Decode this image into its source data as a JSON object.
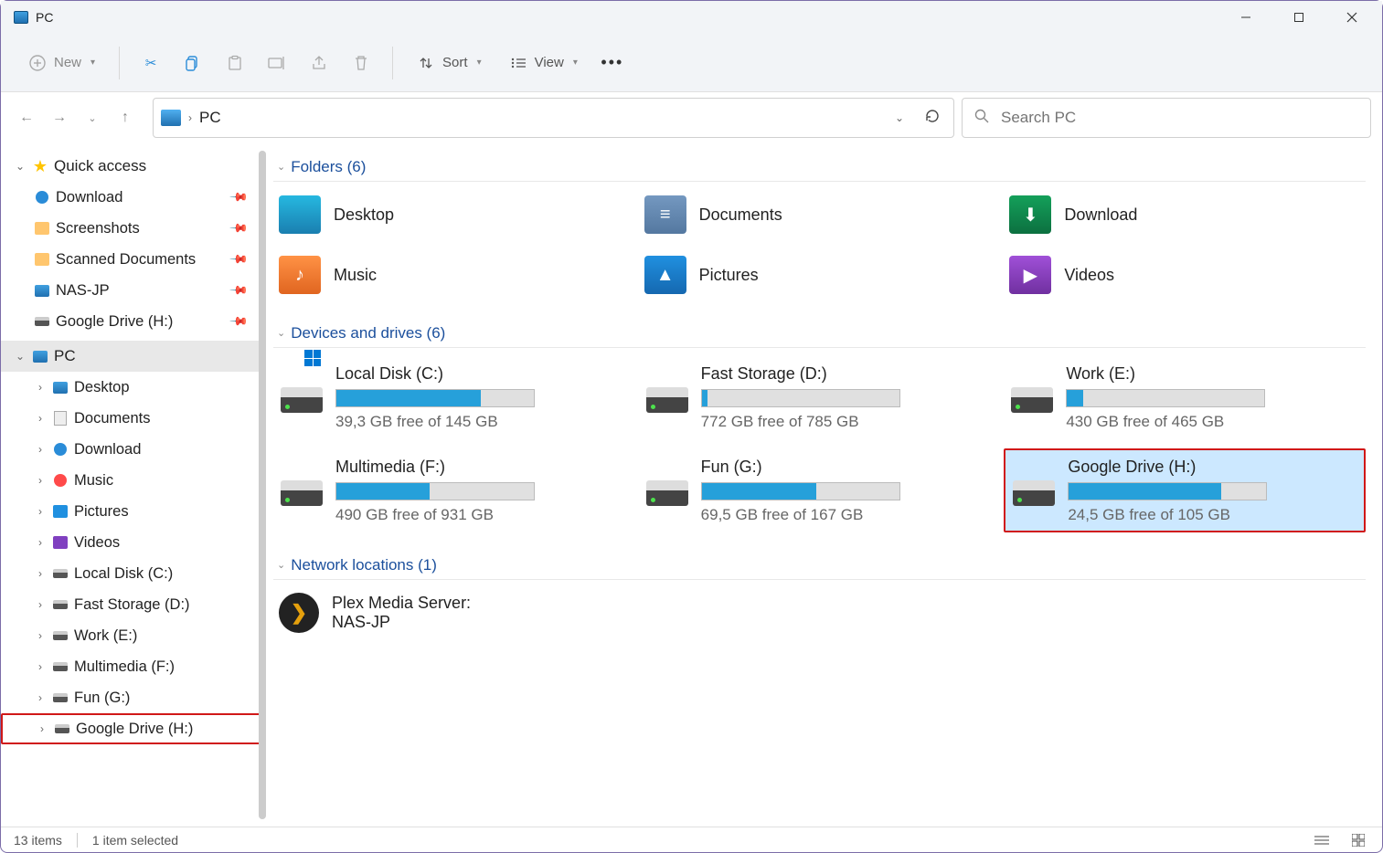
{
  "title": "PC",
  "toolbar": {
    "new_label": "New",
    "sort_label": "Sort",
    "view_label": "View"
  },
  "addressbar": {
    "crumb": "PC"
  },
  "search": {
    "placeholder": "Search PC"
  },
  "nav": {
    "quick_access": "Quick access",
    "qa_items": [
      {
        "label": "Download"
      },
      {
        "label": "Screenshots"
      },
      {
        "label": "Scanned Documents"
      },
      {
        "label": "NAS-JP"
      },
      {
        "label": "Google Drive (H:)"
      }
    ],
    "pc": "PC",
    "pc_items": [
      {
        "label": "Desktop"
      },
      {
        "label": "Documents"
      },
      {
        "label": "Download"
      },
      {
        "label": "Music"
      },
      {
        "label": "Pictures"
      },
      {
        "label": "Videos"
      },
      {
        "label": "Local Disk (C:)"
      },
      {
        "label": "Fast Storage (D:)"
      },
      {
        "label": "Work (E:)"
      },
      {
        "label": "Multimedia (F:)"
      },
      {
        "label": "Fun (G:)"
      },
      {
        "label": "Google Drive (H:)"
      }
    ]
  },
  "groups": {
    "folders_header": "Folders (6)",
    "folders": [
      {
        "label": "Desktop"
      },
      {
        "label": "Documents"
      },
      {
        "label": "Download"
      },
      {
        "label": "Music"
      },
      {
        "label": "Pictures"
      },
      {
        "label": "Videos"
      }
    ],
    "drives_header": "Devices and drives (6)",
    "drives": [
      {
        "label": "Local Disk (C:)",
        "free": "39,3 GB free of 145 GB",
        "fill_pct": 73
      },
      {
        "label": "Fast Storage (D:)",
        "free": "772 GB free of 785 GB",
        "fill_pct": 3
      },
      {
        "label": "Work (E:)",
        "free": "430 GB free of 465 GB",
        "fill_pct": 8
      },
      {
        "label": "Multimedia (F:)",
        "free": "490 GB free of 931 GB",
        "fill_pct": 47
      },
      {
        "label": "Fun (G:)",
        "free": "69,5 GB free of 167 GB",
        "fill_pct": 58
      },
      {
        "label": "Google Drive (H:)",
        "free": "24,5 GB free of 105 GB",
        "fill_pct": 77
      }
    ],
    "network_header": "Network locations (1)",
    "network": [
      {
        "line1": "Plex Media Server:",
        "line2": "NAS-JP"
      }
    ]
  },
  "status": {
    "count": "13 items",
    "selection": "1 item selected"
  }
}
